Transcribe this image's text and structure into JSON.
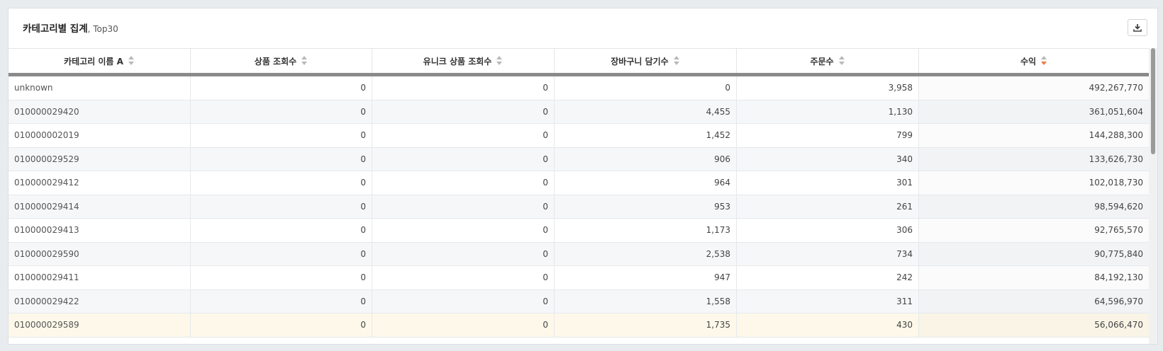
{
  "panel": {
    "title": "카테고리별 집계",
    "subtitle": ", Top30"
  },
  "icons": {
    "download": "download-icon",
    "sort": "sort-arrows-icon"
  },
  "colors": {
    "sort_active": "#f07a3c",
    "highlight_row": "#fdf8ea"
  },
  "table": {
    "columns": [
      "카테고리 이름 A",
      "상품 조회수",
      "유니크 상품 조회수",
      "장바구니 담기수",
      "주문수",
      "수익"
    ],
    "sorted_column": "수익",
    "sort_direction": "desc",
    "rows": [
      [
        "unknown",
        "0",
        "0",
        "0",
        "3,958",
        "492,267,770"
      ],
      [
        "010000029420",
        "0",
        "0",
        "4,455",
        "1,130",
        "361,051,604"
      ],
      [
        "010000002019",
        "0",
        "0",
        "1,452",
        "799",
        "144,288,300"
      ],
      [
        "010000029529",
        "0",
        "0",
        "906",
        "340",
        "133,626,730"
      ],
      [
        "010000029412",
        "0",
        "0",
        "964",
        "301",
        "102,018,730"
      ],
      [
        "010000029414",
        "0",
        "0",
        "953",
        "261",
        "98,594,620"
      ],
      [
        "010000029413",
        "0",
        "0",
        "1,173",
        "306",
        "92,765,570"
      ],
      [
        "010000029590",
        "0",
        "0",
        "2,538",
        "734",
        "90,775,840"
      ],
      [
        "010000029411",
        "0",
        "0",
        "947",
        "242",
        "84,192,130"
      ],
      [
        "010000029422",
        "0",
        "0",
        "1,558",
        "311",
        "64,596,970"
      ],
      [
        "010000029589",
        "0",
        "0",
        "1,735",
        "430",
        "56,066,470"
      ]
    ]
  }
}
